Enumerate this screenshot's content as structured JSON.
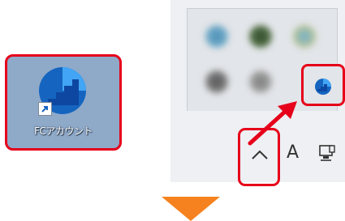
{
  "desktop": {
    "shortcut_label": "FCアカウント",
    "shortcut_icon": "fc-account-app-icon",
    "panel_color": "#8fa9c9"
  },
  "tray": {
    "hidden_icons_icon": "chevron-up-icon",
    "ime_label": "A",
    "network_icon": "wired-network-icon",
    "fc_tray_icon": "fc-account-tray-icon",
    "blurred_icons": [
      "tray-icon-1",
      "tray-icon-2",
      "tray-icon-3",
      "tray-icon-4",
      "tray-icon-5"
    ]
  },
  "colors": {
    "highlight": "#e6001a",
    "arrow": "#f5821f",
    "fc_blue": "#1565c0"
  },
  "arrows": {
    "pointer": "red-pointer-arrow",
    "down": "orange-down-arrow"
  }
}
